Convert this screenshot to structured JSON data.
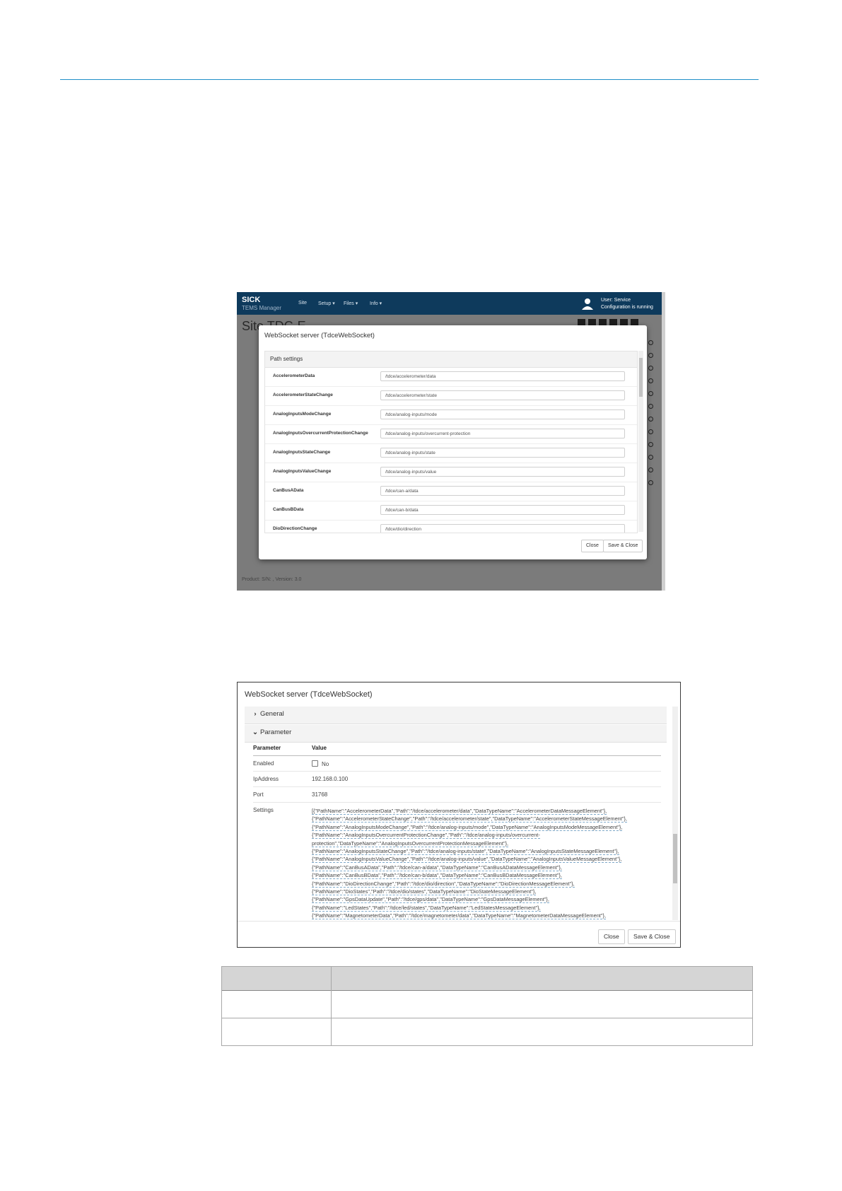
{
  "screenshot1": {
    "brand": "SICK",
    "brand_sub": "TEMS Manager",
    "nav": [
      "Site",
      "Setup ▾",
      "Files ▾",
      "Info ▾"
    ],
    "user_line1": "User: Service",
    "user_line2": "Configuration is running",
    "page_title": "Site TDC-E",
    "footer": "Product:   S/N:   , Version: 3.0",
    "modal": {
      "title": "WebSocket server (TdceWebSocket)",
      "panel_title": "Path settings",
      "rows": [
        {
          "label": "AccelerometerData",
          "value": "/tdce/accelerometer/data"
        },
        {
          "label": "AccelerometerStateChange",
          "value": "/tdce/accelerometer/state"
        },
        {
          "label": "AnalogInputsModeChange",
          "value": "/tdce/analog-inputs/mode"
        },
        {
          "label": "AnalogInputsOvercurrentProtectionChange",
          "value": "/tdce/analog-inputs/overcurrent-protection"
        },
        {
          "label": "AnalogInputsStateChange",
          "value": "/tdce/analog-inputs/state"
        },
        {
          "label": "AnalogInputsValueChange",
          "value": "/tdce/analog-inputs/value"
        },
        {
          "label": "CanBusAData",
          "value": "/tdce/can-a/data"
        },
        {
          "label": "CanBusBData",
          "value": "/tdce/can-b/data"
        },
        {
          "label": "DioDirectionChange",
          "value": "/tdce/dio/direction"
        }
      ],
      "close_label": "Close",
      "save_close_label": "Save & Close"
    }
  },
  "screenshot2": {
    "title": "WebSocket server (TdceWebSocket)",
    "general_label": "General",
    "parameter_label": "Parameter",
    "col_parameter": "Parameter",
    "col_value": "Value",
    "enabled_label": "Enabled",
    "enabled_value": "No",
    "ip_label": "IpAddress",
    "ip_value": "192.168.0.100",
    "port_label": "Port",
    "port_value": "31768",
    "settings_label": "Settings",
    "settings_lines": [
      "[{\"PathName\":\"AccelerometerData\",\"Path\":\"/tdce/accelerometer/data\",\"DataTypeName\":\"AccelerometerDataMessageElement\"},",
      "{\"PathName\":\"AccelerometerStateChange\",\"Path\":\"/tdce/accelerometer/state\",\"DataTypeName\":\"AccelerometerStateMessageElement\"},",
      "{\"PathName\":\"AnalogInputsModeChange\",\"Path\":\"/tdce/analog-inputs/mode\",\"DataTypeName\":\"AnalogInputsModeMessageElement\"},",
      "{\"PathName\":\"AnalogInputsOvercurrentProtectionChange\",\"Path\":\"/tdce/analog-inputs/overcurrent-",
      "protection\",\"DataTypeName\":\"AnalogInputsOvercurrentProtectionMessageElement\"},",
      "{\"PathName\":\"AnalogInputsStateChange\",\"Path\":\"/tdce/analog-inputs/state\",\"DataTypeName\":\"AnalogInputsStateMessageElement\"},",
      "{\"PathName\":\"AnalogInputsValueChange\",\"Path\":\"/tdce/analog-inputs/value\",\"DataTypeName\":\"AnalogInputsValueMessageElement\"},",
      "{\"PathName\":\"CanBusAData\",\"Path\":\"/tdce/can-a/data\",\"DataTypeName\":\"CanBusADataMessageElement\"},",
      "{\"PathName\":\"CanBusBData\",\"Path\":\"/tdce/can-b/data\",\"DataTypeName\":\"CanBusBDataMessageElement\"},",
      "{\"PathName\":\"DioDirectionChange\",\"Path\":\"/tdce/dio/direction\",\"DataTypeName\":\"DioDirectionMessageElement\"},",
      "{\"PathName\":\"DioStates\",\"Path\":\"/tdce/dio/states\",\"DataTypeName\":\"DioStateMessageElement\"},",
      "{\"PathName\":\"GpsDataUpdate\",\"Path\":\"/tdce/gps/data\",\"DataTypeName\":\"GpsDataMessageElement\"},",
      "{\"PathName\":\"LedStates\",\"Path\":\"/tdce/led/states\",\"DataTypeName\":\"LedStatesMessageElement\"},",
      "{\"PathName\":\"MagnetometerData\",\"Path\":\"/tdce/magnetometer/data\",\"DataTypeName\":\"MagnetometerDataMessageElement\"},"
    ],
    "close_label": "Close",
    "save_close_label": "Save & Close"
  }
}
